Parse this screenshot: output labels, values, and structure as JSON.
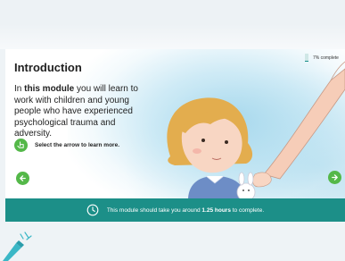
{
  "intro": {
    "title": "Introduction",
    "paragraph_prefix": "In ",
    "paragraph_bold": "this module",
    "paragraph_suffix": " you will learn to work with children and young people who have experienced psychological trauma and adversity.",
    "hint": "Select the arrow to learn more."
  },
  "progress": {
    "label": "7% complete",
    "value": 0.07
  },
  "footer": {
    "text_before": "This module should take you around ",
    "duration": "1.25 hours",
    "text_after": " to complete."
  },
  "icons": {
    "hint": "hand-pointer-icon",
    "prev": "arrow-left-icon",
    "next": "arrow-right-icon",
    "footer": "clock-icon"
  },
  "colors": {
    "accent_green": "#54b849",
    "footer_teal": "#1c8f88"
  }
}
